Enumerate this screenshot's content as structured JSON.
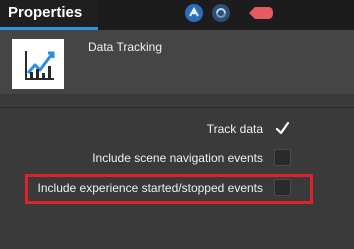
{
  "tabs": {
    "properties": "Properties"
  },
  "toolbar": {
    "icons": [
      "status-icon",
      "sync-icon",
      "badge-shape-icon"
    ],
    "colors": {
      "tab_accent": "#2f8fe0",
      "badge": "#e85a62"
    }
  },
  "component": {
    "title": "Data Tracking",
    "icon": "line-chart-icon"
  },
  "settings": {
    "track_data": {
      "label": "Track data",
      "checked": true
    },
    "scene_navigation": {
      "label": "Include scene navigation events",
      "checked": false
    },
    "experience_events": {
      "label": "Include experience started/stopped events",
      "checked": false,
      "highlighted": true
    }
  },
  "highlight_color": "#e0202a"
}
